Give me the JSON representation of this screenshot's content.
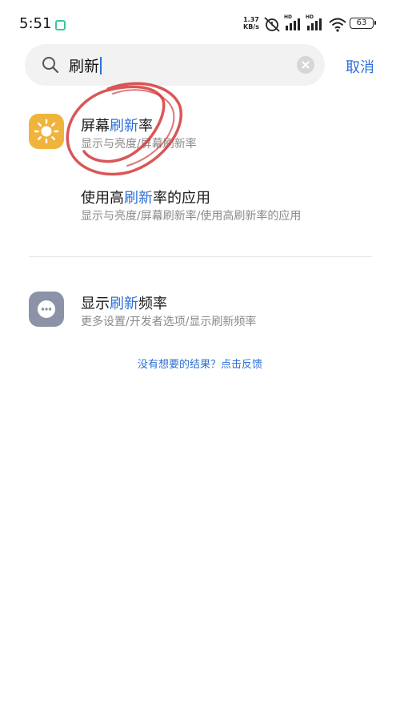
{
  "status_bar": {
    "time": "5:51",
    "net_speed_value": "1.37",
    "net_speed_unit": "KB/s",
    "hd1": "HD",
    "hd2": "HD",
    "battery": "63"
  },
  "search": {
    "query": "刷新",
    "cancel_label": "取消"
  },
  "results": [
    {
      "title_pre": "屏幕",
      "title_hl": "刷新",
      "title_post": "率",
      "path": "显示与亮度/屏幕刷新率",
      "icon": "brightness-icon",
      "icon_color": "#f0b43c"
    },
    {
      "title_pre": "使用高",
      "title_hl": "刷新",
      "title_post": "率的应用",
      "path": "显示与亮度/屏幕刷新率/使用高刷新率的应用"
    },
    {
      "title_pre": "显示",
      "title_hl": "刷新",
      "title_post": "频率",
      "path": "更多设置/开发者选项/显示刷新频率",
      "icon": "more-icon",
      "icon_color": "#8c93a8"
    }
  ],
  "feedback_link": "没有想要的结果？点击反馈",
  "colors": {
    "accent": "#2e6fd6",
    "annotation": "#d23a3a"
  }
}
